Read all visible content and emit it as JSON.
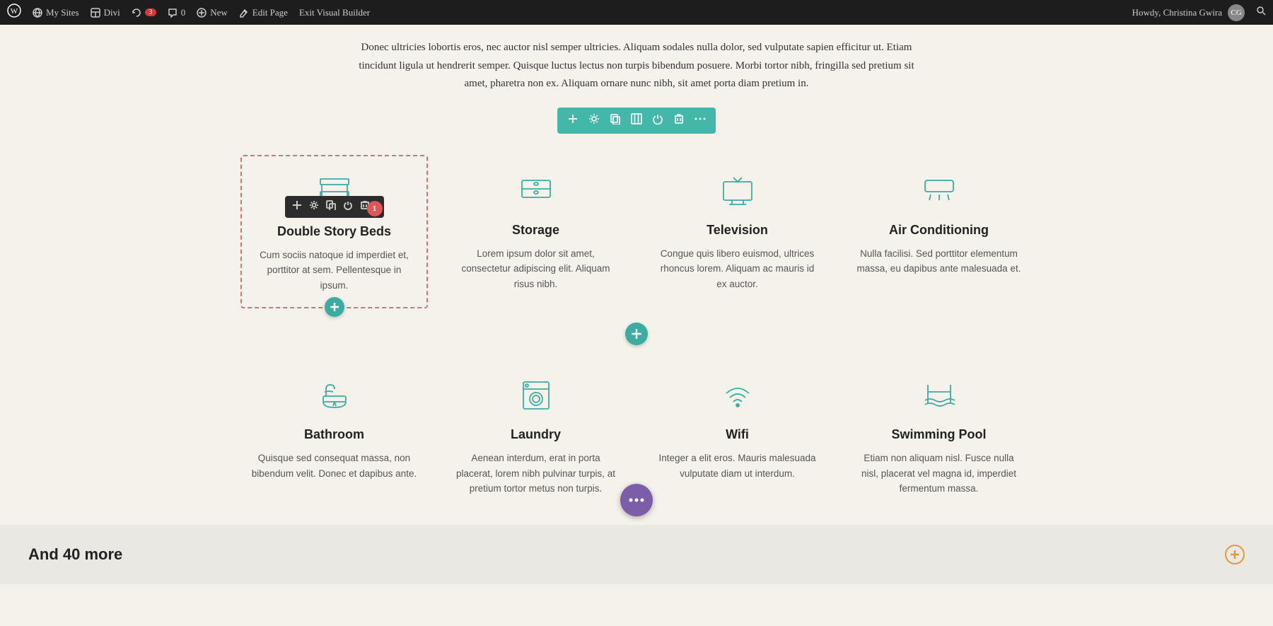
{
  "adminBar": {
    "wpLogo": "⊕",
    "mySites": "My Sites",
    "divi": "Divi",
    "updates": "3",
    "comments": "0",
    "newLabel": "New",
    "editPage": "Edit Page",
    "exitBuilder": "Exit Visual Builder",
    "userGreeting": "Howdy, Christina Gwira",
    "searchIcon": "🔍"
  },
  "introText": {
    "paragraph": "Donec ultricies lobortis eros, nec auctor nisl semper ultricies. Aliquam sodales nulla dolor, sed vulputate sapien efficitur ut. Etiam tincidunt ligula ut hendrerit semper. Quisque luctus lectus non turpis bibendum posuere. Morbi tortor nibh, fringilla sed pretium sit amet, pharetra non ex. Aliquam ornare nunc nibh, sit amet porta diam pretium in."
  },
  "moduleToolbar": {
    "icons": [
      "+",
      "⚙",
      "❒",
      "⊞",
      "⏻",
      "🗑",
      "⋮"
    ]
  },
  "inlineToolbar": {
    "icons": [
      "+",
      "⚙",
      "❒",
      "⏻",
      "🗑"
    ]
  },
  "notificationBadge": "1",
  "features": {
    "row1": [
      {
        "id": "double-story-beds",
        "title": "Double Story Beds",
        "desc": "Cum sociis natoque id imperdiet et, porttitor at sem. Pellentesque in ipsum.",
        "iconType": "bunk-bed"
      },
      {
        "id": "storage",
        "title": "Storage",
        "desc": "Lorem ipsum dolor sit amet, consectetur adipiscing elit. Aliquam risus nibh.",
        "iconType": "storage-bed"
      },
      {
        "id": "television",
        "title": "Television",
        "desc": "Congue quis libero euismod, ultrices rhoncus lorem. Aliquam ac mauris id ex auctor.",
        "iconType": "television"
      },
      {
        "id": "air-conditioning",
        "title": "Air Conditioning",
        "desc": "Nulla facilisi. Sed porttitor elementum massa, eu dapibus ante malesuada et.",
        "iconType": "ac-unit"
      }
    ],
    "row2": [
      {
        "id": "bathroom",
        "title": "Bathroom",
        "desc": "Quisque sed consequat massa, non bibendum velit. Donec et dapibus ante.",
        "iconType": "bathtub"
      },
      {
        "id": "laundry",
        "title": "Laundry",
        "desc": "Aenean interdum, erat in porta placerat, lorem nibh pulvinar turpis, at pretium tortor metus non turpis.",
        "iconType": "washing-machine"
      },
      {
        "id": "wifi",
        "title": "Wifi",
        "desc": "Integer a elit eros. Mauris malesuada vulputate diam ut interdum.",
        "iconType": "wifi"
      },
      {
        "id": "swimming-pool",
        "title": "Swimming Pool",
        "desc": "Etiam non aliquam nisl. Fusce nulla nisl, placerat vel magna id, imperdiet fermentum massa.",
        "iconType": "swimming-pool"
      }
    ]
  },
  "andMore": {
    "title": "And 40 more"
  },
  "moreOptionsBtn": "...",
  "addBtnSymbol": "+"
}
